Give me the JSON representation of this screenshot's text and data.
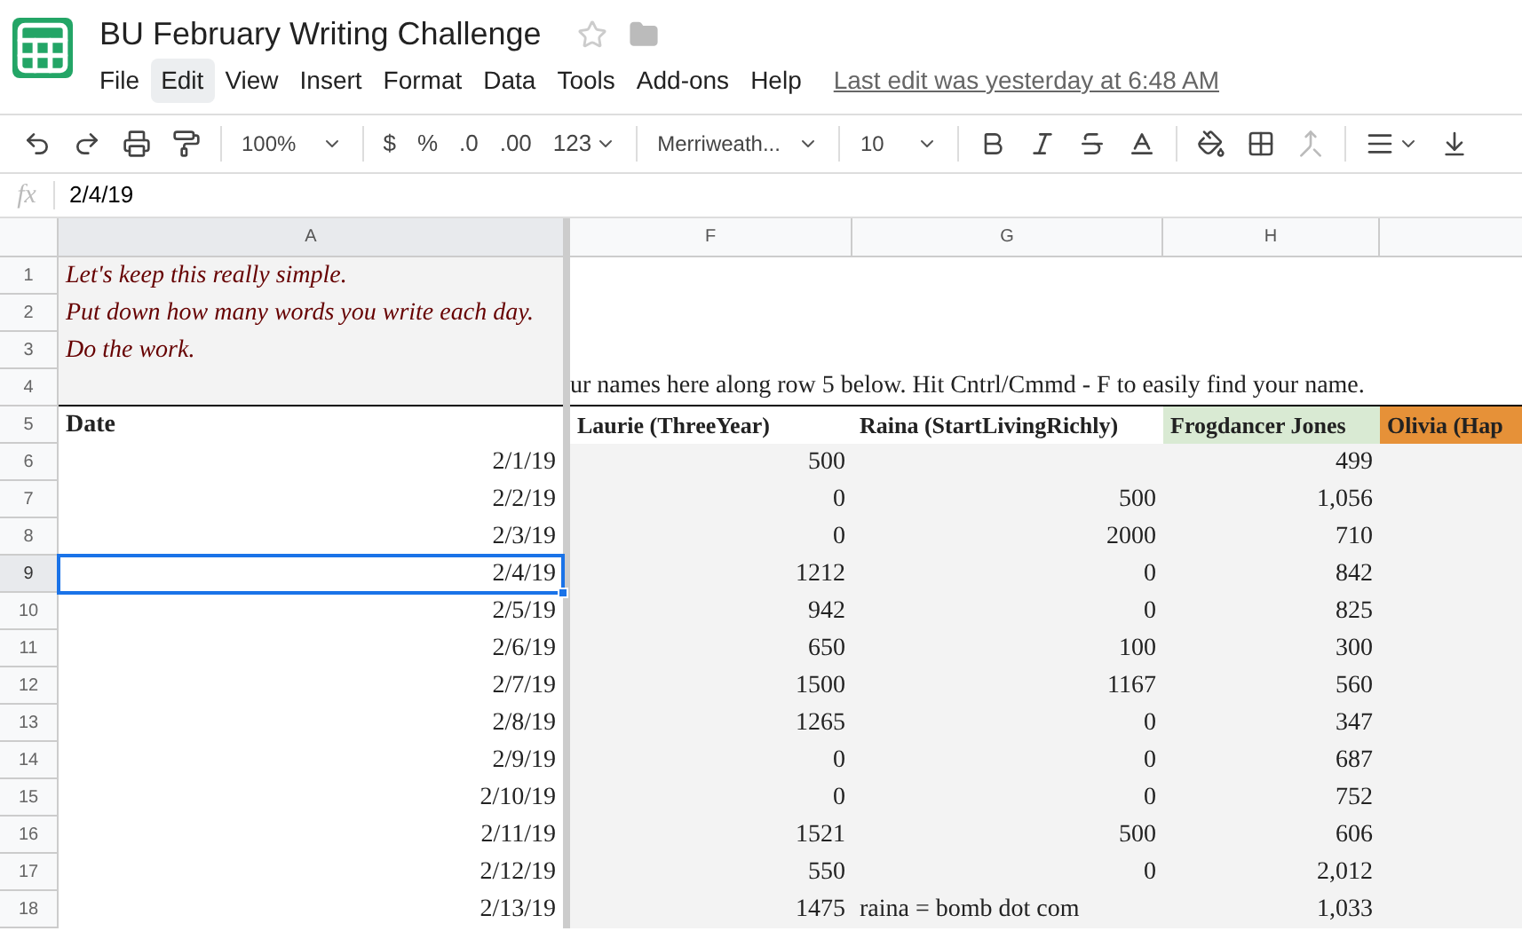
{
  "title": "BU February Writing Challenge",
  "menu": [
    {
      "label": "File",
      "selected": false
    },
    {
      "label": "Edit",
      "selected": true
    },
    {
      "label": "View",
      "selected": false
    },
    {
      "label": "Insert",
      "selected": false
    },
    {
      "label": "Format",
      "selected": false
    },
    {
      "label": "Data",
      "selected": false
    },
    {
      "label": "Tools",
      "selected": false
    },
    {
      "label": "Add-ons",
      "selected": false
    },
    {
      "label": "Help",
      "selected": false
    }
  ],
  "last_edit": "Last edit was yesterday at 6:48 AM",
  "toolbar": {
    "zoom": "100%",
    "currency": "$",
    "percent": "%",
    "decrease_decimals": ".0",
    "increase_decimals": ".00",
    "number_format": "123",
    "font": "Merriweath...",
    "font_size": "10"
  },
  "formula_bar": {
    "label": "fx",
    "value": "2/4/19"
  },
  "columns": [
    "A",
    "F",
    "G",
    "H"
  ],
  "notes": [
    {
      "row": "1",
      "text": "Let's keep this really simple."
    },
    {
      "row": "2",
      "text": "Put down how many words you write each day."
    },
    {
      "row": "3",
      "text": "Do the work."
    }
  ],
  "instruction": {
    "row": "4",
    "text": "ur names here along row 5 below. Hit Cntrl/Cmmd - F to easily find your name."
  },
  "header": {
    "row": "5",
    "date": "Date",
    "names": [
      {
        "text": "Laurie (ThreeYear)",
        "color": "#ffffff"
      },
      {
        "text": "Raina (StartLivingRichly)",
        "color": "#ffffff"
      },
      {
        "text": "Frogdancer Jones",
        "color": "#d9ead3"
      },
      {
        "text": "Olivia (Hap",
        "color": "#e69138"
      }
    ]
  },
  "rows": [
    {
      "row": "6",
      "date": "2/1/19",
      "f": "500",
      "g": "",
      "h": "499",
      "selected": false
    },
    {
      "row": "7",
      "date": "2/2/19",
      "f": "0",
      "g": "500",
      "h": "1,056",
      "selected": false
    },
    {
      "row": "8",
      "date": "2/3/19",
      "f": "0",
      "g": "2000",
      "h": "710",
      "selected": false
    },
    {
      "row": "9",
      "date": "2/4/19",
      "f": "1212",
      "g": "0",
      "h": "842",
      "selected": true
    },
    {
      "row": "10",
      "date": "2/5/19",
      "f": "942",
      "g": "0",
      "h": "825",
      "selected": false
    },
    {
      "row": "11",
      "date": "2/6/19",
      "f": "650",
      "g": "100",
      "h": "300",
      "selected": false
    },
    {
      "row": "12",
      "date": "2/7/19",
      "f": "1500",
      "g": "1167",
      "h": "560",
      "selected": false
    },
    {
      "row": "13",
      "date": "2/8/19",
      "f": "1265",
      "g": "0",
      "h": "347",
      "selected": false
    },
    {
      "row": "14",
      "date": "2/9/19",
      "f": "0",
      "g": "0",
      "h": "687",
      "selected": false
    },
    {
      "row": "15",
      "date": "2/10/19",
      "f": "0",
      "g": "0",
      "h": "752",
      "selected": false
    },
    {
      "row": "16",
      "date": "2/11/19",
      "f": "1521",
      "g": "500",
      "h": "606",
      "selected": false
    },
    {
      "row": "17",
      "date": "2/12/19",
      "f": "550",
      "g": "0",
      "h": "2,012",
      "selected": false
    },
    {
      "row": "18",
      "date": "2/13/19",
      "f": "1475",
      "g": "raina = bomb dot com",
      "kind": "comment",
      "h": "1,033",
      "selected": false
    }
  ]
}
